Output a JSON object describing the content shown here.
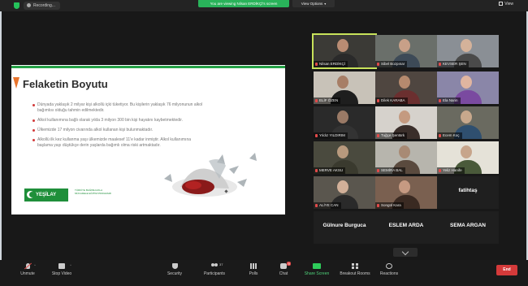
{
  "topbar": {
    "recording": "Recording...",
    "viewing": "You are viewing Nilsan ERDİKÇİ's screen",
    "view_options": "View Options",
    "view": "View"
  },
  "slide": {
    "title": "Felaketin Boyutu",
    "bullets": [
      "Dünyada yaklaşık 2 milyar kişi alkollü içki tüketiyor. Bu kişilerin yaklaşık 76 milyonunun alkol bağımlısı olduğu tahmin edilmektedir.",
      "Alkol kullanımına bağlı olarak yılda 3 milyon 300 bin kişi hayatını kaybetmektedir.",
      "Ülkemizde 17 milyon civarında alkol kullanan kişi bulunmaktadır.",
      "Alkollü ilk kez kullanma yaşı ülkemizde maalesef 11'e kadar inmiştir. Alkol kullanımına başlama yaşı düştükçe derin yaşlarda bağımlı olma riski artmaktadır."
    ],
    "brand": "YEŞİLAY",
    "brand_sub": "TÜRKİYE BAĞIMLILIKLA MÜCADELE EĞİTİM PROGRAMI"
  },
  "participants": [
    {
      "name": "Nilsan ERDİKÇİ",
      "bg": "#3b3a36",
      "skin": "#b98c73",
      "cloth": "#2a2a2a",
      "active": true
    },
    {
      "name": "Sibel Bozpınar",
      "bg": "#6a6f6a",
      "skin": "#c8a088",
      "cloth": "#3d4a57",
      "active": false
    },
    {
      "name": "KEVSER ŞEN",
      "bg": "#8a8f95",
      "skin": "#d4b29a",
      "cloth": "#4a4a4a",
      "active": false
    },
    {
      "name": "ELİF ÖZEN",
      "bg": "#c8c2b8",
      "skin": "#a77e66",
      "cloth": "#1e1e1e",
      "active": false
    },
    {
      "name": "Dilek KARABA",
      "bg": "#4f4640",
      "skin": "#b58a6e",
      "cloth": "#6b2f2f",
      "active": false
    },
    {
      "name": "Ela Narin",
      "bg": "#8a86a8",
      "skin": "#e0b5a0",
      "cloth": "#7a4aa0",
      "active": false
    },
    {
      "name": "Yıldız YILDIRIM",
      "bg": "#2a2a2a",
      "skin": "#9a7a66",
      "cloth": "#333333",
      "active": false
    },
    {
      "name": "Tuğçe Şentürk",
      "bg": "#d6d2cc",
      "skin": "#c49a80",
      "cloth": "#3a2e2a",
      "active": false
    },
    {
      "name": "Ecem Koç",
      "bg": "#6a6a60",
      "skin": "#c8a88c",
      "cloth": "#2f4f6f",
      "active": false
    },
    {
      "name": "MERVE AKSU",
      "bg": "#4a4a3e",
      "skin": "#b89a7e",
      "cloth": "#3a3a2e",
      "active": false
    },
    {
      "name": "SEMİRA BAL",
      "bg": "#b7b5ad",
      "skin": "#a88a74",
      "cloth": "#5a4a3e",
      "active": false
    },
    {
      "name": "Yeliz Hanife",
      "bg": "#e5e2d8",
      "skin": "#c7a58b",
      "cloth": "#4a5a3a",
      "active": false
    },
    {
      "name": "ALİYE CAN",
      "bg": "#5a564e",
      "skin": "#d2b099",
      "cloth": "#2a2a2a",
      "active": false
    },
    {
      "name": "Songül Kara",
      "bg": "#7a6050",
      "skin": "#c69a82",
      "cloth": "#3a2a22",
      "active": false
    },
    {
      "name": "fatihtaş",
      "bg": "#1f1f1f",
      "skin": "",
      "cloth": "",
      "active": false,
      "nameonly": true
    },
    {
      "name": "Gülnure Burguca",
      "bg": "#1f1f1f",
      "skin": "",
      "cloth": "",
      "active": false,
      "nameonly": true
    },
    {
      "name": "ESLEM ARDA",
      "bg": "#1f1f1f",
      "skin": "",
      "cloth": "",
      "active": false,
      "nameonly": true
    },
    {
      "name": "SEMA ARGAN",
      "bg": "#1f1f1f",
      "skin": "",
      "cloth": "",
      "active": false,
      "nameonly": true
    }
  ],
  "toolbar": {
    "unmute": "Unmute",
    "stop_video": "Stop Video",
    "security": "Security",
    "participants": "Participants",
    "participants_count": "37",
    "polls": "Polls",
    "chat": "Chat",
    "chat_badge": "9",
    "share_screen": "Share Screen",
    "breakout_rooms": "Breakout Rooms",
    "reactions": "Reactions",
    "end": "End"
  },
  "colors": {
    "accent_green": "#25c25b",
    "end_red": "#d43a3a",
    "slide_orange": "#e8742c"
  }
}
